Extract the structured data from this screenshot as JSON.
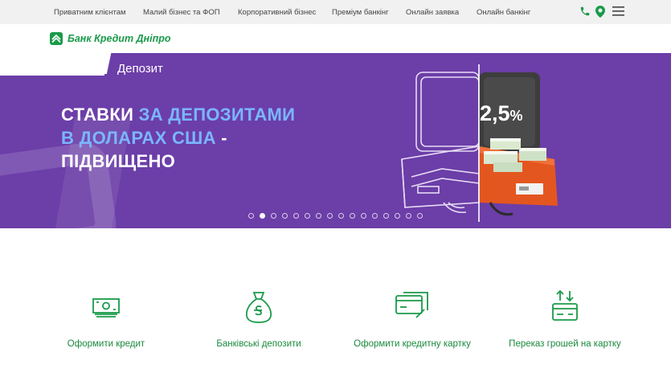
{
  "nav": {
    "links": [
      "Приватним клієнтам",
      "Малий бізнес та ФОП",
      "Корпоративний бізнес",
      "Преміум банкінг",
      "Онлайн заявка",
      "Онлайн банкінг"
    ]
  },
  "brand": {
    "name": "Банк Кредит Дніпро",
    "color": "#1a9a4a"
  },
  "banner": {
    "category": "Депозит",
    "headline_1_white": "СТАВКИ ",
    "headline_1_blue": "ЗА ДЕПОЗИТАМИ",
    "headline_2_blue": "В ДОЛАРАХ США",
    "headline_2_white": " -",
    "headline_3_white": "ПІДВИЩЕНО",
    "rate_value": "2,5",
    "rate_unit": "%",
    "background": "#6c3ea8",
    "slides_total": 16,
    "slide_active": 2
  },
  "services": [
    {
      "label": "Оформити кредит",
      "icon": "banknotes-icon"
    },
    {
      "label": "Банківські депозити",
      "icon": "money-bag-icon"
    },
    {
      "label": "Оформити кредитну картку",
      "icon": "credit-cards-icon"
    },
    {
      "label": "Переказ грошей на картку",
      "icon": "card-transfer-icon"
    }
  ]
}
